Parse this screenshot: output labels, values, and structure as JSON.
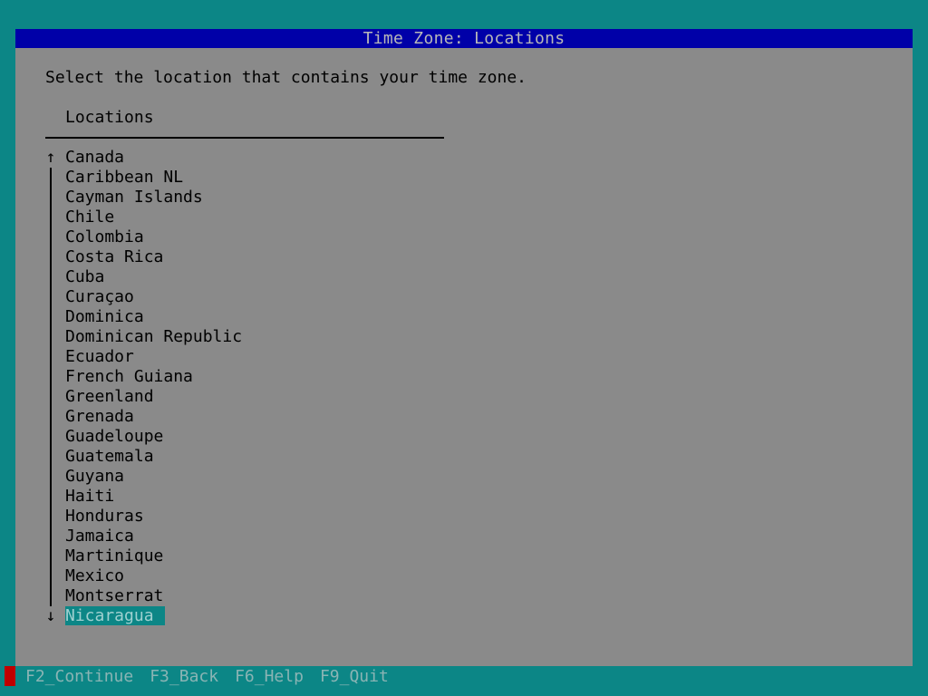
{
  "dialog": {
    "title": "Time Zone: Locations",
    "prompt": "Select the location that contains your time zone.",
    "list_header": "Locations",
    "scroll_up_glyph": "↑",
    "scroll_down_glyph": "↓",
    "items": [
      "Canada",
      "Caribbean NL",
      "Cayman Islands",
      "Chile",
      "Colombia",
      "Costa Rica",
      "Cuba",
      "Curaçao",
      "Dominica",
      "Dominican Republic",
      "Ecuador",
      "French Guiana",
      "Greenland",
      "Grenada",
      "Guadeloupe",
      "Guatemala",
      "Guyana",
      "Haiti",
      "Honduras",
      "Jamaica",
      "Martinique",
      "Mexico",
      "Montserrat",
      "Nicaragua"
    ],
    "selected_item": "Nicaragua"
  },
  "function_keys": [
    "F2_Continue",
    "F3_Back",
    "F6_Help",
    "F9_Quit"
  ],
  "colors": {
    "background": "#0c8686",
    "panel": "#8a8a8a",
    "title_bar": "#0000a8",
    "selection": "#0c8686",
    "status_marker": "#c00000"
  }
}
